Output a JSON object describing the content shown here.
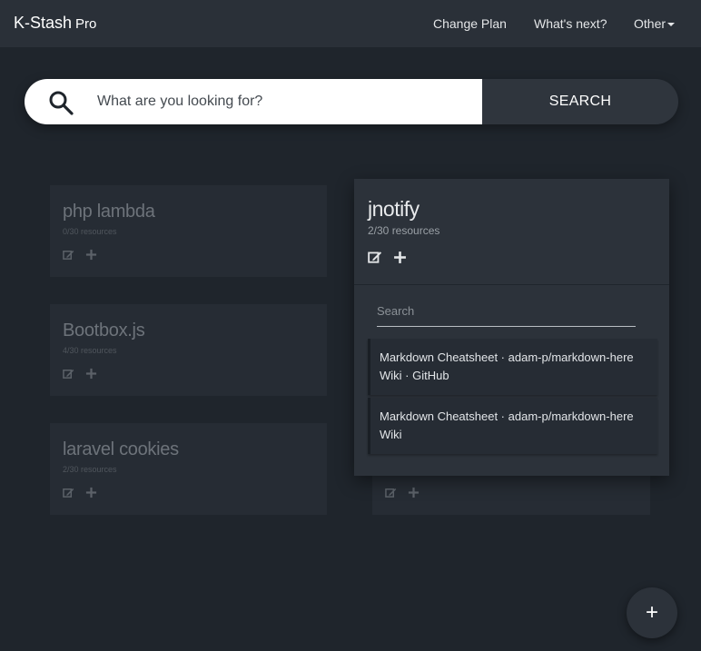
{
  "navbar": {
    "brand": "K-Stash",
    "brand_suffix": "Pro",
    "links": [
      "Change Plan",
      "What's next?",
      "Other"
    ]
  },
  "search": {
    "placeholder": "What are you looking for?",
    "button_label": "SEARCH"
  },
  "stashes": [
    {
      "title": "php lambda",
      "resources": "0/30 resources"
    },
    {
      "title": "Bootbox.js",
      "resources": "4/30 resources"
    },
    {
      "title": "laravel cookies",
      "resources": "2/30 resources"
    }
  ],
  "active_stash": {
    "title": "jnotify",
    "resources": "2/30 resources",
    "search_placeholder": "Search",
    "items": [
      "Markdown Cheatsheet · adam-p/markdown-here Wiki · GitHub",
      "Markdown Cheatsheet · adam-p/markdown-here Wiki"
    ]
  },
  "fab_label": "+",
  "colors": {
    "background": "#1f252c",
    "navbar": "#2a3038",
    "card": "#262c34",
    "active_card": "#2c323a"
  },
  "icons": [
    "search-icon",
    "edit-icon",
    "plus-icon"
  ]
}
